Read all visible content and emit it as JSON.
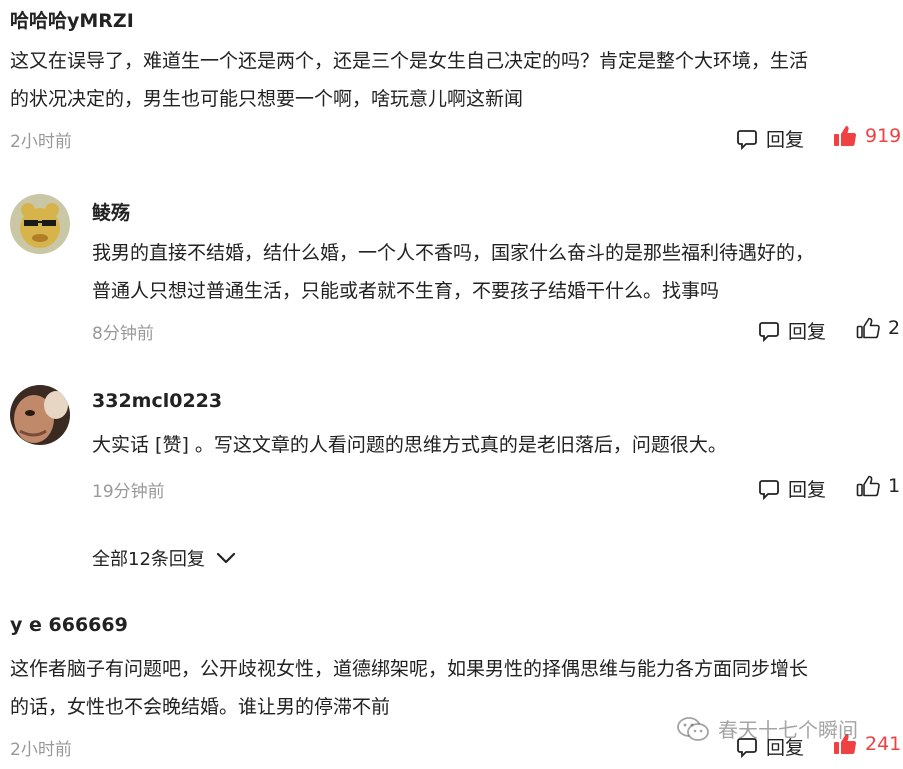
{
  "comments": [
    {
      "username": "哈哈哈yMRZI",
      "lines": [
        "这又在误导了，难道生一个还是两个，还是三个是女生自己决定的吗？肯定是整个大环境，生活",
        "的状况决定的，男生也可能只想要一个啊，啥玩意儿啊这新闻"
      ],
      "time": "2小时前",
      "reply_label": "回复",
      "likes": "919"
    },
    {
      "username": "y e 666669",
      "lines": [
        "这作者脑子有问题吧，公开歧视女性，道德绑架呢，如果男性的择偶思维与能力各方面同步增长",
        "的话，女性也不会晚结婚。谁让男的停滞不前"
      ],
      "time": "2小时前",
      "reply_label": "回复",
      "likes": "241"
    }
  ],
  "replies": [
    {
      "username": "鲮殇",
      "lines": [
        "我男的直接不结婚，结什么婚，一个人不香吗，国家什么奋斗的是那些福利待遇好的，",
        "普通人只想过普通生活，只能或者就不生育，不要孩子结婚干什么。找事吗"
      ],
      "time": "8分钟前",
      "reply_label": "回复",
      "likes": "2"
    },
    {
      "username": "332mcl0223",
      "lines": [
        "大实话 [赞] 。写这文章的人看问题的思维方式真的是老旧落后，问题很大。"
      ],
      "time": "19分钟前",
      "reply_label": "回复",
      "likes": "1"
    }
  ],
  "expand_replies_label": "全部12条回复",
  "watermark_text": "春天十七个瞬间",
  "colors": {
    "liked": "#f04142",
    "muted": "#999999",
    "text": "#222222"
  }
}
